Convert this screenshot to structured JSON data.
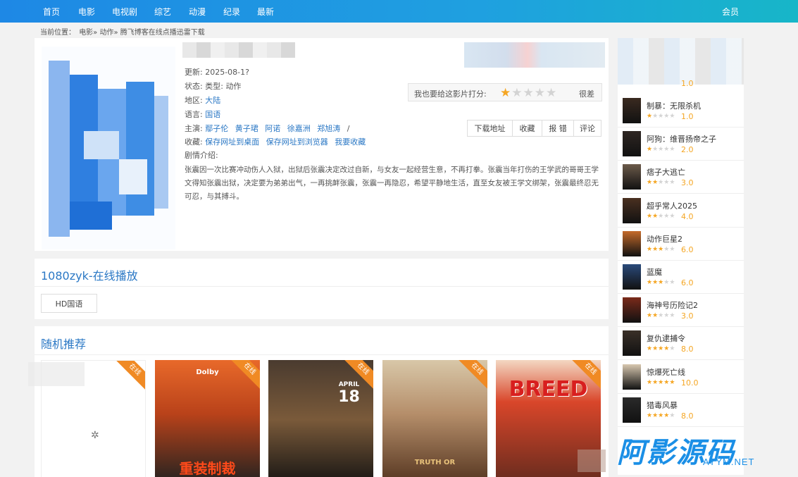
{
  "nav": {
    "items": [
      "首页",
      "电影",
      "电视剧",
      "综艺",
      "动漫",
      "纪录",
      "最新"
    ],
    "member": "会员"
  },
  "breadcrumb": {
    "prefix": "当前位置：",
    "path": "电影» 动作» 腾飞博客在线点播迅雷下载"
  },
  "detail": {
    "update_label": "更新:",
    "update_value": "2025-08-1?",
    "status_label": "状态:",
    "type_label": "类型:",
    "type_value": "动作",
    "region_label": "地区:",
    "region_value": "大陆",
    "language_label": "语言:",
    "language_value": "国语",
    "cast_label": "主演:",
    "cast": [
      "鄢子伦",
      "黄子珺",
      "阿诺",
      "徐嘉洲",
      "郑旭涛"
    ],
    "cast_end": "/",
    "fav_label": "收藏:",
    "fav_links": [
      "保存网址到桌面",
      "保存网址到浏览器",
      "我要收藏"
    ],
    "summary_label": "剧情介绍:",
    "summary": "张震因一次比赛冲动伤人入狱，出狱后张震决定改过自新，与女友一起经营生意，不再打拳。张震当年打伤的王学武的哥哥王学文得知张震出狱，决定要为弟弟出气，一再挑衅张震，张震一再隐忍，希望平静地生活，直至女友被王学文绑架，张震最终忍无可忍，与其搏斗。",
    "rating": {
      "label": "我也要给这影片打分:",
      "stars": 1,
      "max": 5,
      "text": "很差"
    },
    "actions": [
      "下载地址",
      "收藏",
      "报 错",
      "评论"
    ]
  },
  "play": {
    "title": "1080zyk-在线播放",
    "episodes": [
      "HD国语"
    ]
  },
  "random": {
    "title": "随机推荐",
    "badge": "在线",
    "cards": [
      {
        "art_top": "",
        "art_bottom": ""
      },
      {
        "art_top": "Dolby",
        "art_bottom": "重装制裁"
      },
      {
        "art_top": "APRIL",
        "art_bottom": "18"
      },
      {
        "art_top": "",
        "art_bottom": "TRUTH OR"
      },
      {
        "art_top": "BREED",
        "art_bottom": ""
      }
    ]
  },
  "sidebar": {
    "first_score": "1.0",
    "items": [
      {
        "name": "制暴：无限杀机",
        "stars": 0.5,
        "score": "1.0"
      },
      {
        "name": "阿狗：维晋扬帝之子",
        "stars": 1,
        "score": "2.0"
      },
      {
        "name": "痞子大逃亡",
        "stars": 1.5,
        "score": "3.0"
      },
      {
        "name": "超乎常人2025",
        "stars": 2,
        "score": "4.0"
      },
      {
        "name": "动作巨星2",
        "stars": 3,
        "score": "6.0"
      },
      {
        "name": "蓝魔",
        "stars": 3,
        "score": "6.0"
      },
      {
        "name": "海神号历险记2",
        "stars": 1.5,
        "score": "3.0"
      },
      {
        "name": "复仇逮捕令",
        "stars": 4,
        "score": "8.0"
      },
      {
        "name": "惊爆死亡线",
        "stars": 5,
        "score": "10.0"
      },
      {
        "name": "猎毒风暴",
        "stars": 4,
        "score": "8.0"
      }
    ]
  },
  "watermark": {
    "cn": "阿影源码",
    "en": "AYYM.NET"
  },
  "colors": {
    "nav": "#1e88e5",
    "link": "#2b78c5",
    "star": "#f5a623",
    "badge": "#f08a24"
  }
}
